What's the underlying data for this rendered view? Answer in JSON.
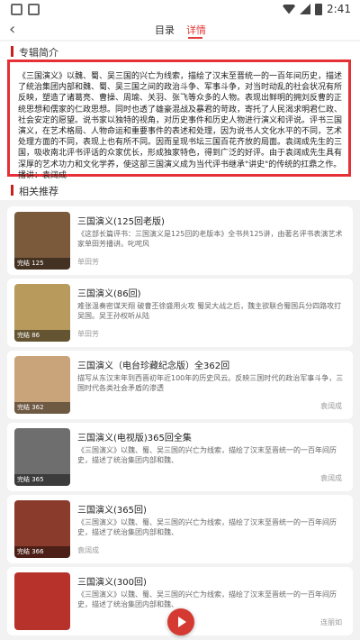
{
  "status_bar": {
    "time": "2:41"
  },
  "nav": {
    "back_icon": "‹",
    "tabs": [
      {
        "label": "目录"
      },
      {
        "label": "详情"
      }
    ],
    "active_tab": "详情"
  },
  "sections": {
    "intro_title": "专辑简介",
    "rec_title": "相关推荐"
  },
  "intro": {
    "text": "《三国演义》以魏、蜀、吴三国的兴亡为线索，描绘了汉末至晋统一的一百年间历史，描述了统治集团内部和魏、蜀、吴三国之间的政治斗争、军事斗争，对当时动乱的社会状况有所反映，塑造了诸葛亮、曹操、周瑜、关羽、张飞等众多的人物。表现出鲜明的拥刘反曹的正统思想和儒家的仁政思想。同时也透了雄豪混战及暴君的苛政，寄托了人民渴求明君仁政、社会安定的愿望。说书家以独特的视角，对历史事件和历史人物进行演义和评说。评书三国演义，在艺术格局、人物命运和重要事件的表述和处理，因为说书人文化水平的不同，艺术处理方面的不同，表现上也有所不同。因而呈现书坛三国百花齐放的局面。袁阔成先生的三国，吸收南北评书评话的众家优长，形成独家特色，得到广泛的好评。由于袁阔成先生具有深厚的艺术功力和文化学养，使这部三国演义成为当代评书继承\"讲史\"的传统的扛鼎之作。播讲：袁阔成"
  },
  "recommendations": [
    {
      "title": "三国演义(125回老版)",
      "desc": "《这部长篇评书：三国演义是125回的老版本》全书共125讲，由著名评书表演艺术家单田芳播讲。叱咤风",
      "author": "单田芳",
      "author_align": "left",
      "count": "完结 125",
      "cover_color": "#7b5a3c"
    },
    {
      "title": "三国演义(86回)",
      "desc": "难张温奏密谋天翔  破曹丕徐盛用火攻  蜀吴大战之后，魏主欲联合蜀国兵分四路攻打吴国。吴王孙权听从陆",
      "author": "单田芳",
      "author_align": "left",
      "count": "完结 86",
      "cover_color": "#b79a5c"
    },
    {
      "title": "三国演义（电台珍藏纪念版）全362回",
      "desc": "描写从东汉末年到西晋初年近100年的历史风云。反映三国时代的政治军事斗争，三国时代各类社会矛盾的渗透",
      "author": "袁阔成",
      "author_align": "right",
      "count": "完结 362",
      "cover_color": "#c9a37a"
    },
    {
      "title": "三国演义(电视版)365回全集",
      "desc": "《三国演义》以魏、蜀、吴三国的兴亡为线索，描绘了汉末至晋统一的一百年间历史，描述了统治集团内部和魏、",
      "author": "袁阔成",
      "author_align": "right",
      "count": "完结 365",
      "cover_color": "#6e6e6e"
    },
    {
      "title": "三国演义(365回)",
      "desc": "《三国演义》以魏、蜀、吴三国的兴亡为线索，描绘了汉末至晋统一的一百年间历史，描述了统治集团内部和魏、",
      "author": "袁阔成",
      "author_align": "left",
      "count": "完结 366",
      "cover_color": "#8a3b2b"
    },
    {
      "title": "三国演义(300回)",
      "desc": "《三国演义》以魏、蜀、吴三国的兴亡为线索，描绘了汉末至晋统一的一百年间历史，描述了统治集团内部和魏、",
      "author": "连丽如",
      "author_align": "right",
      "count": "",
      "cover_color": "#b8322c"
    }
  ],
  "colors": {
    "accent": "#e23b3b",
    "highlight_border": "#e53135"
  }
}
